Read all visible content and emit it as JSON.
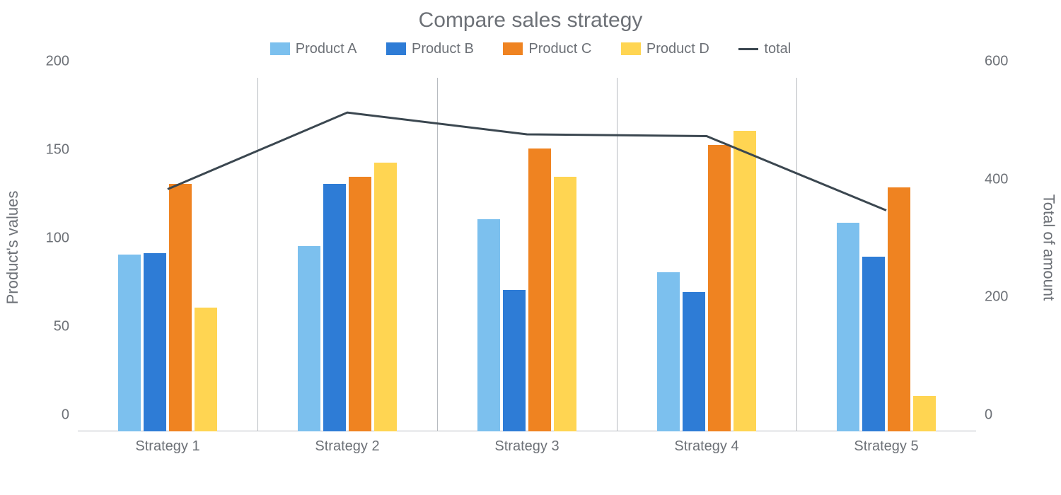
{
  "chart_data": {
    "type": "bar",
    "title": "Compare sales strategy",
    "categories": [
      "Strategy 1",
      "Strategy 2",
      "Strategy 3",
      "Strategy 4",
      "Strategy 5"
    ],
    "series": [
      {
        "name": "Product A",
        "values": [
          100,
          105,
          120,
          90,
          118
        ]
      },
      {
        "name": "Product B",
        "values": [
          101,
          140,
          80,
          79,
          99
        ]
      },
      {
        "name": "Product C",
        "values": [
          140,
          144,
          160,
          162,
          138
        ]
      },
      {
        "name": "Product D",
        "values": [
          70,
          152,
          144,
          170,
          20
        ]
      }
    ],
    "line_series": {
      "name": "total",
      "values": [
        411,
        541,
        504,
        501,
        375
      ]
    },
    "ylabel": "Product's values",
    "y2label": "Total of amount",
    "ylim": [
      0,
      200
    ],
    "y2lim": [
      0,
      600
    ],
    "yticks": [
      0,
      50,
      100,
      150,
      200
    ],
    "y2ticks": [
      0,
      200,
      400,
      600
    ],
    "colors": {
      "Product A": "#7cc0ee",
      "Product B": "#2e7cd6",
      "Product C": "#ef8321",
      "Product D": "#ffd552",
      "total": "#3b4750"
    },
    "legend_position": "top",
    "grid": "vertical"
  }
}
